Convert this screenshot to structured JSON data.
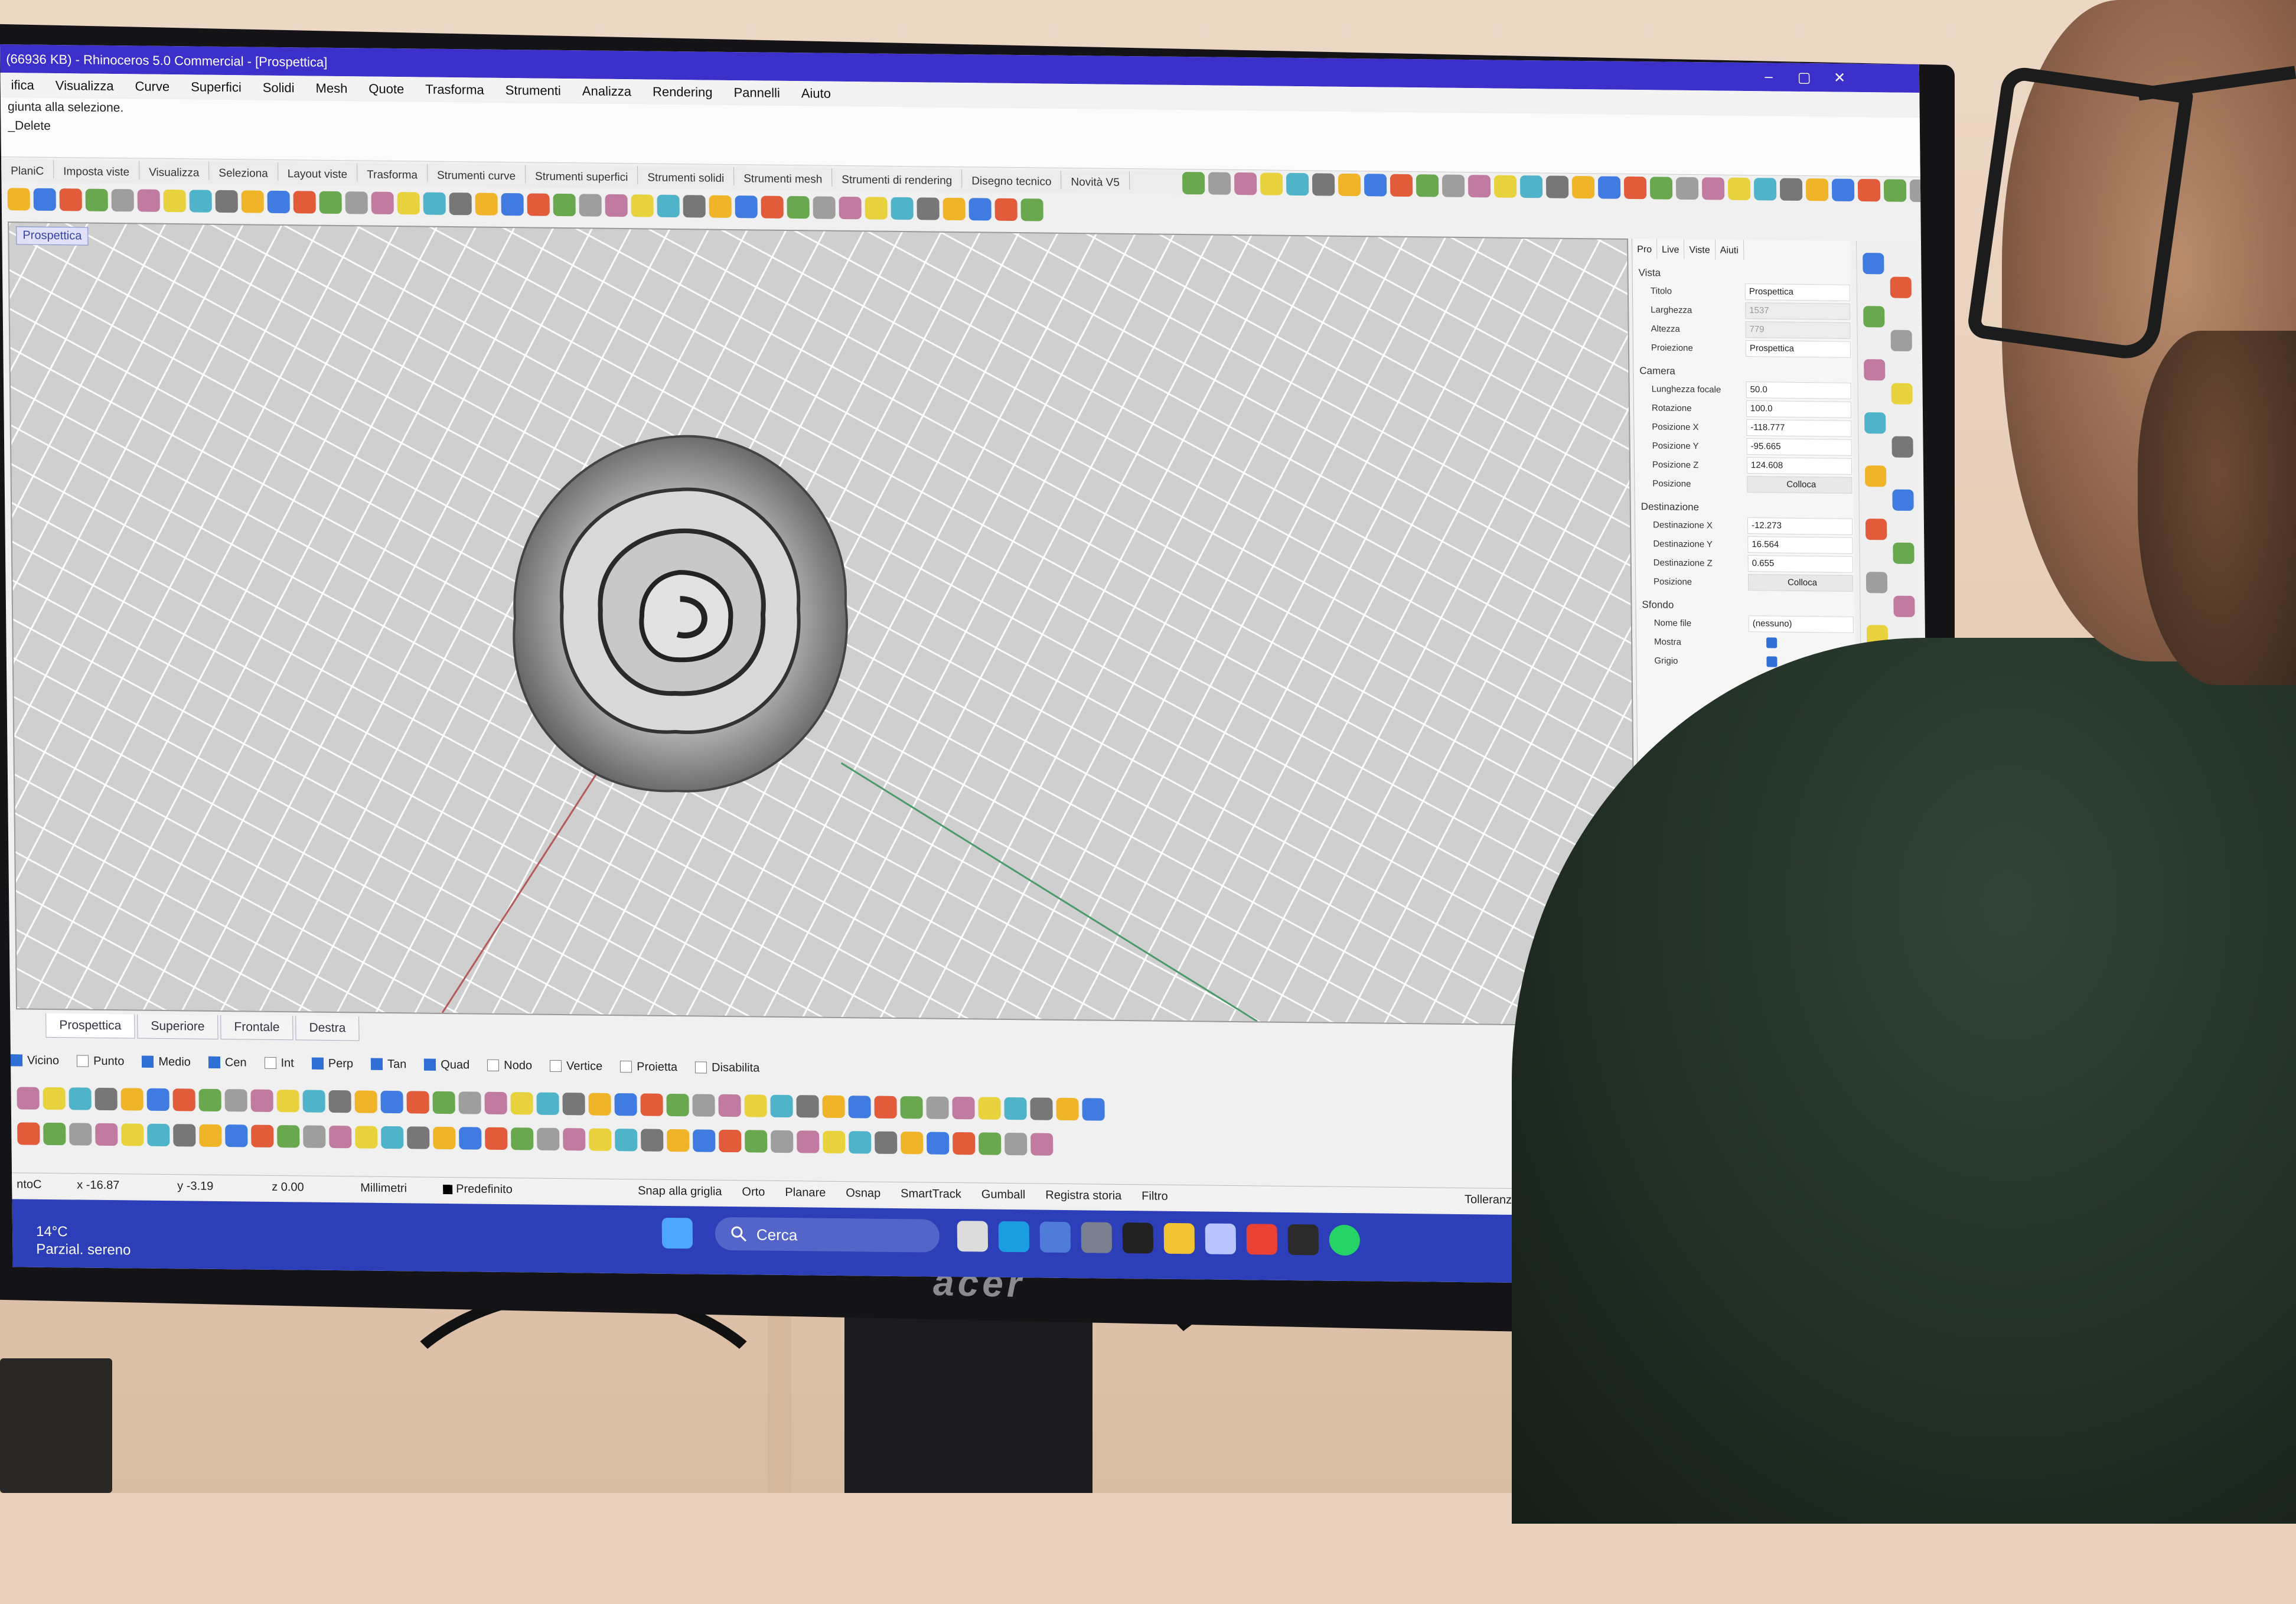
{
  "window": {
    "title": "(66936 KB) - Rhinoceros 5.0 Commercial - [Prospettica]"
  },
  "menu": [
    "ifica",
    "Visualizza",
    "Curve",
    "Superfici",
    "Solidi",
    "Mesh",
    "Quote",
    "Trasforma",
    "Strumenti",
    "Analizza",
    "Rendering",
    "Pannelli",
    "Aiuto"
  ],
  "command": {
    "line1": "giunta alla selezione.",
    "line2": "_Delete"
  },
  "toolbar_tabs": [
    "PlaniC",
    "Imposta viste",
    "Visualizza",
    "Seleziona",
    "Layout viste",
    "Trasforma",
    "Strumenti curve",
    "Strumenti superfici",
    "Strumenti solidi",
    "Strumenti mesh",
    "Strumenti di rendering",
    "Disegno tecnico",
    "Novità V5"
  ],
  "viewport": {
    "label": "Prospettica"
  },
  "properties": {
    "tabs": [
      "Pro",
      "Live",
      "Viste",
      "Aiuti"
    ],
    "sections": {
      "vista": "Vista",
      "camera": "Camera",
      "destinazione": "Destinazione",
      "sfondo": "Sfondo"
    },
    "vista_rows": [
      {
        "k": "Titolo",
        "v": "Prospettica",
        "dim": false
      },
      {
        "k": "Larghezza",
        "v": "1537",
        "dim": true
      },
      {
        "k": "Altezza",
        "v": "779",
        "dim": true
      },
      {
        "k": "Proiezione",
        "v": "Prospettica",
        "dim": false
      }
    ],
    "camera_rows": [
      {
        "k": "Lunghezza focale",
        "v": "50.0"
      },
      {
        "k": "Rotazione",
        "v": "100.0"
      },
      {
        "k": "Posizione X",
        "v": "-118.777"
      },
      {
        "k": "Posizione Y",
        "v": "-95.665"
      },
      {
        "k": "Posizione Z",
        "v": "124.608"
      },
      {
        "k": "Posizione",
        "v": "Colloca"
      }
    ],
    "dest_rows": [
      {
        "k": "Destinazione X",
        "v": "-12.273"
      },
      {
        "k": "Destinazione Y",
        "v": "16.564"
      },
      {
        "k": "Destinazione Z",
        "v": "0.655"
      },
      {
        "k": "Posizione",
        "v": "Colloca"
      }
    ],
    "sfondo_rows": [
      {
        "k": "Nome file",
        "v": "(nessuno)"
      },
      {
        "k": "Mostra",
        "v": ""
      },
      {
        "k": "Grigio",
        "v": ""
      }
    ]
  },
  "view_tabs": [
    "Prospettica",
    "Superiore",
    "Frontale",
    "Destra"
  ],
  "osnap": [
    {
      "label": "Vicino",
      "on": true
    },
    {
      "label": "Punto",
      "on": false
    },
    {
      "label": "Medio",
      "on": true
    },
    {
      "label": "Cen",
      "on": true
    },
    {
      "label": "Int",
      "on": false
    },
    {
      "label": "Perp",
      "on": true
    },
    {
      "label": "Tan",
      "on": true
    },
    {
      "label": "Quad",
      "on": true
    },
    {
      "label": "Nodo",
      "on": false
    },
    {
      "label": "Vertice",
      "on": false
    },
    {
      "label": "Proietta",
      "on": false
    },
    {
      "label": "Disabilita",
      "on": false
    }
  ],
  "status": {
    "cplane": "ntoC",
    "x": "x -16.87",
    "y": "y -3.19",
    "z": "z 0.00",
    "units": "Millimetri",
    "layer": "Predefinito",
    "buttons": [
      "Snap alla griglia",
      "Orto",
      "Planare",
      "Osnap",
      "SmartTrack",
      "Gumball",
      "Registra storia",
      "Filtro"
    ],
    "tolerance": "Tolleranza assoluta: 0.01"
  },
  "taskbar": {
    "search": "Cerca",
    "temp": "14°C",
    "weather": "Parzial. sereno"
  },
  "brand": "acer",
  "colors": {
    "titlebar": "#3b30c9",
    "taskbar": "#2c3fb8",
    "accent": "#2f6fd6"
  }
}
